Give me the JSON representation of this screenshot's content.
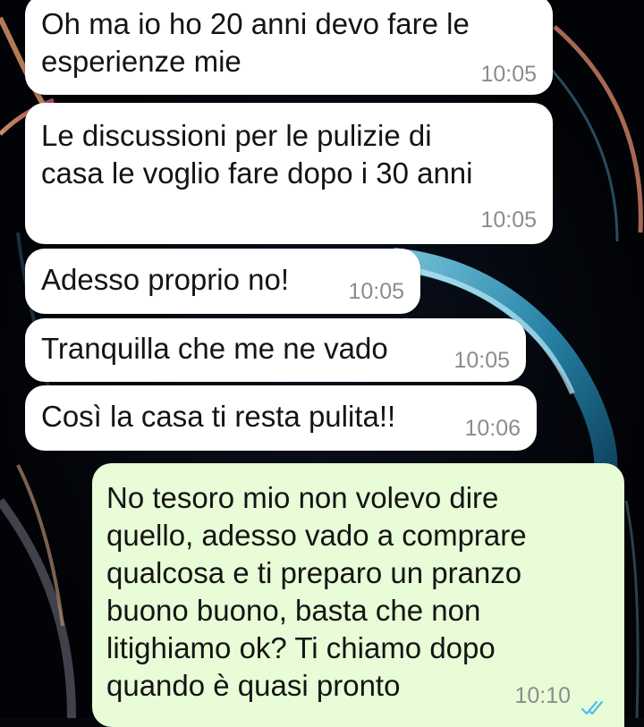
{
  "messages": [
    {
      "direction": "incoming",
      "text": "Oh ma io ho 20 anni devo fare le\nesperienze mie",
      "time": "10:05"
    },
    {
      "direction": "incoming",
      "text": "Le discussioni per le pulizie di\ncasa le voglio fare dopo i 30 anni",
      "time": "10:05"
    },
    {
      "direction": "incoming",
      "text": "Adesso proprio no!",
      "time": "10:05"
    },
    {
      "direction": "incoming",
      "text": "Tranquilla che me ne vado",
      "time": "10:05"
    },
    {
      "direction": "incoming",
      "text": "Così la casa ti resta pulita!!",
      "time": "10:06"
    },
    {
      "direction": "outgoing",
      "text": "No tesoro mio non volevo dire\nquello, adesso vado a comprare\nqualcosa e ti preparo un pranzo\nbuono buono, basta che non\nlitighiamo ok? Ti chiamo dopo\nquando è quasi pronto",
      "time": "10:10",
      "status": "read",
      "status_icon": "double-check-icon"
    }
  ],
  "colors": {
    "incoming_bubble": "#ffffff",
    "outgoing_bubble": "#e7fcd7",
    "timestamp": "#8c8c8c",
    "read_ticks": "#53bdeb",
    "wallpaper": "#05070c"
  }
}
